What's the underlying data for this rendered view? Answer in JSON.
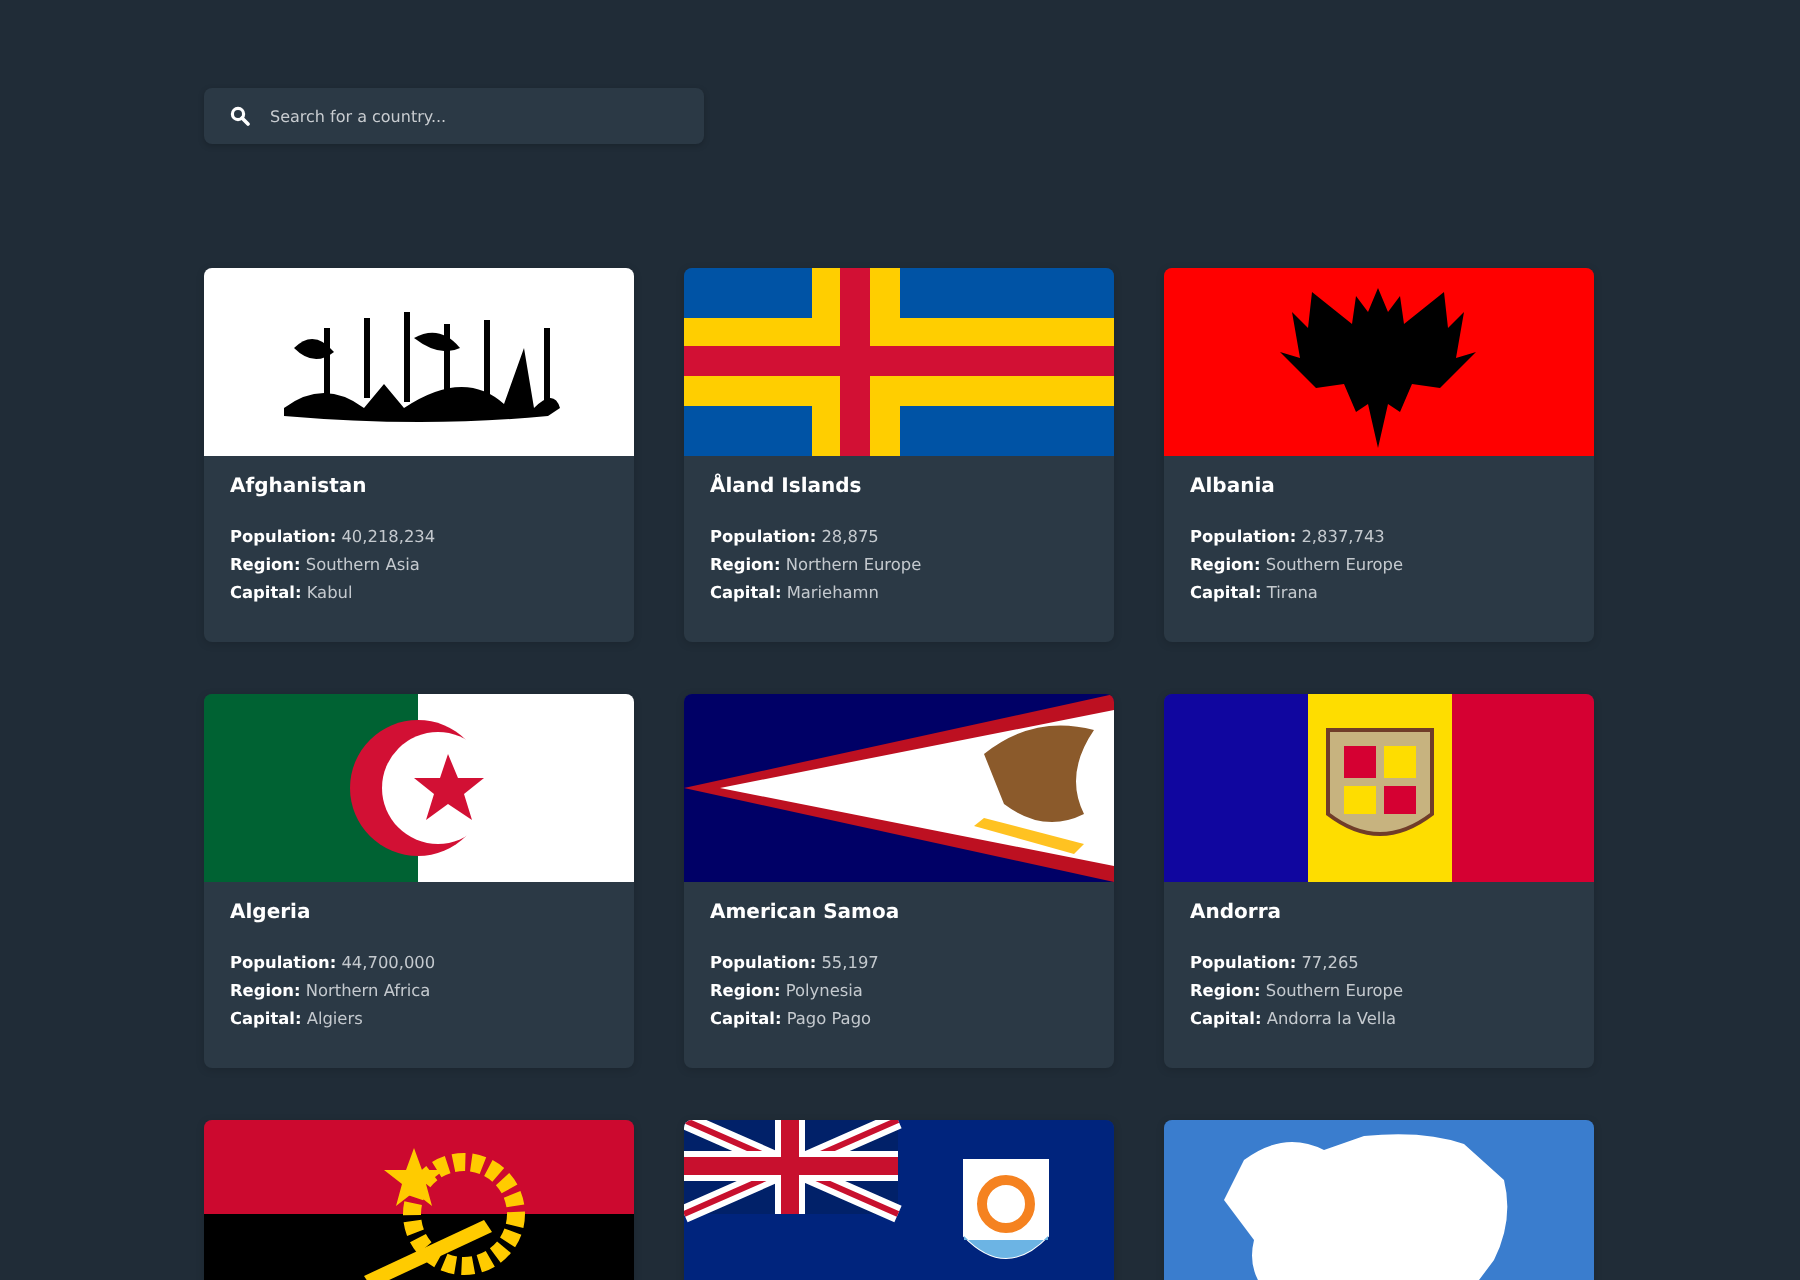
{
  "search": {
    "placeholder": "Search for a country..."
  },
  "countries": [
    {
      "kind": "afghanistan",
      "name": "Afghanistan",
      "details": [
        "**Population:** 40,218,234",
        "**Region:** Southern Asia",
        "**Capital:** Kabul"
      ]
    },
    {
      "kind": "aland",
      "name": "Åland Islands",
      "details": [
        "**Population:** 28,875",
        "**Region:** Northern Europe",
        "**Capital:** Mariehamn"
      ]
    },
    {
      "kind": "albania",
      "name": "Albania",
      "details": [
        "**Population:** 2,837,743",
        "**Region:** Southern Europe",
        "**Capital:** Tirana"
      ]
    },
    {
      "kind": "algeria",
      "name": "Algeria",
      "details": [
        "**Population:** 44,700,000",
        "**Region:** Northern Africa",
        "**Capital:** Algiers"
      ]
    },
    {
      "kind": "samoa",
      "name": "American Samoa",
      "details": [
        "**Population:** 55,197",
        "**Region:** Polynesia",
        "**Capital:** Pago Pago"
      ]
    },
    {
      "kind": "andorra",
      "name": "Andorra",
      "details": [
        "**Population:** 77,265",
        "**Region:** Southern Europe",
        "**Capital:** Andorra la Vella"
      ]
    },
    {
      "kind": "angola"
    },
    {
      "kind": "anguilla"
    },
    {
      "kind": "antarctica"
    }
  ]
}
